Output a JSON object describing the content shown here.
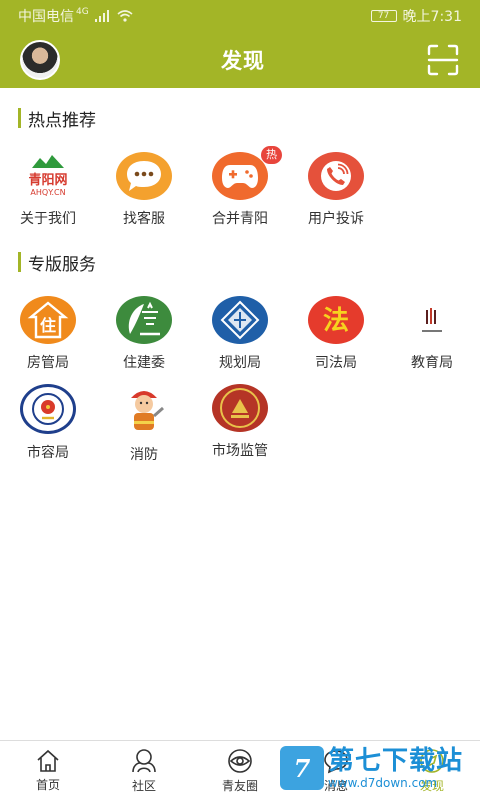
{
  "status_bar": {
    "carrier": "中国电信",
    "network": "4G",
    "battery": "77",
    "time": "晚上7:31"
  },
  "header": {
    "title": "发现"
  },
  "sections": [
    {
      "title": "热点推荐",
      "items": [
        {
          "label": "关于我们",
          "icon": "qingyang-logo-icon",
          "logo_text": "青阳网",
          "logo_sub": "AHQY.CN"
        },
        {
          "label": "找客服",
          "icon": "chat-bubble-icon"
        },
        {
          "label": "合并青阳",
          "icon": "gamepad-icon",
          "badge": "热"
        },
        {
          "label": "用户投诉",
          "icon": "phone-icon"
        }
      ]
    },
    {
      "title": "专版服务",
      "items": [
        {
          "label": "房管局",
          "icon": "housing-bureau-icon",
          "glyph": "住"
        },
        {
          "label": "住建委",
          "icon": "construction-committee-icon"
        },
        {
          "label": "规划局",
          "icon": "planning-bureau-icon"
        },
        {
          "label": "司法局",
          "icon": "justice-bureau-icon",
          "glyph": "法"
        },
        {
          "label": "教育局",
          "icon": "education-bureau-icon"
        },
        {
          "label": "市容局",
          "icon": "city-appearance-emblem-icon"
        },
        {
          "label": "消防",
          "icon": "firefighter-icon"
        },
        {
          "label": "市场监管",
          "icon": "market-supervision-emblem-icon"
        }
      ]
    }
  ],
  "tab_bar": {
    "tabs": [
      {
        "label": "首页",
        "icon": "home-icon"
      },
      {
        "label": "社区",
        "icon": "community-icon"
      },
      {
        "label": "青友圈",
        "icon": "eye-circle-icon"
      },
      {
        "label": "消息",
        "icon": "message-icon"
      },
      {
        "label": "发现",
        "icon": "discover-icon",
        "active": true
      }
    ]
  },
  "watermark": {
    "logo": "7",
    "main": "第七下载站",
    "sub": "www.d7down.com"
  },
  "colors": {
    "brand": "#a3b527",
    "hot_badge": "#e8453c",
    "orange": "#f08a1c",
    "red": "#e5513b",
    "navy": "#1f3f8c"
  }
}
